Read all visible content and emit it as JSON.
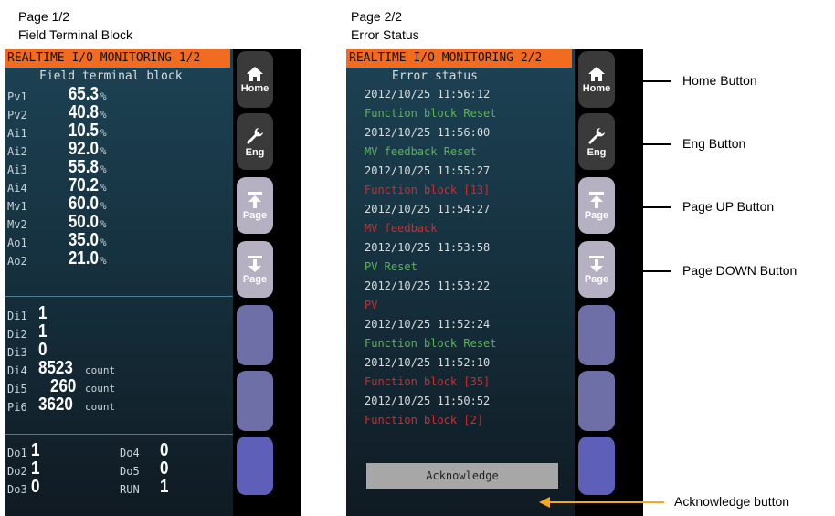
{
  "left": {
    "caption_page": "Page 1/2",
    "caption_title": "Field Terminal Block",
    "header": "REALTIME I/O MONITORING 1/2",
    "subtitle": "Field terminal block",
    "analog": [
      {
        "label": "Pv1",
        "value": "65.3",
        "unit": "%"
      },
      {
        "label": "Pv2",
        "value": "40.8",
        "unit": "%"
      },
      {
        "label": "Ai1",
        "value": "10.5",
        "unit": "%"
      },
      {
        "label": "Ai2",
        "value": "92.0",
        "unit": "%"
      },
      {
        "label": "Ai3",
        "value": "55.8",
        "unit": "%"
      },
      {
        "label": "Ai4",
        "value": "70.2",
        "unit": "%"
      },
      {
        "label": "Mv1",
        "value": "60.0",
        "unit": "%"
      },
      {
        "label": "Mv2",
        "value": "50.0",
        "unit": "%"
      },
      {
        "label": "Ao1",
        "value": "35.0",
        "unit": "%"
      },
      {
        "label": "Ao2",
        "value": "21.0",
        "unit": "%"
      }
    ],
    "digital": [
      {
        "label": "Di1",
        "value": "1",
        "unit": ""
      },
      {
        "label": "Di2",
        "value": "1",
        "unit": ""
      },
      {
        "label": "Di3",
        "value": "0",
        "unit": ""
      },
      {
        "label": "Di4",
        "value": "8523",
        "unit": "count"
      },
      {
        "label": "Di5",
        "value": "260",
        "unit": "count"
      },
      {
        "label": "Pi6",
        "value": "3620",
        "unit": "count"
      }
    ],
    "outputs": [
      {
        "label": "Do1",
        "value": "1"
      },
      {
        "label": "Do2",
        "value": "1"
      },
      {
        "label": "Do3",
        "value": "0"
      },
      {
        "label": "Do4",
        "value": "0"
      },
      {
        "label": "Do5",
        "value": "0"
      },
      {
        "label": "RUN",
        "value": "1"
      }
    ]
  },
  "right": {
    "caption_page": "Page 2/2",
    "caption_title": "Error Status",
    "header": "REALTIME I/O MONITORING 2/2",
    "subtitle": "Error status",
    "errors": [
      {
        "time": "2012/10/25 11:56:12",
        "msg": "Function block Reset",
        "color": "#5ab552"
      },
      {
        "time": "2012/10/25 11:56:00",
        "msg": "MV feedback Reset",
        "color": "#5ab552"
      },
      {
        "time": "2012/10/25 11:55:27",
        "msg": "Function block [13]",
        "color": "#d12b2b"
      },
      {
        "time": "2012/10/25 11:54:27",
        "msg": "MV feedback",
        "color": "#d12b2b"
      },
      {
        "time": "2012/10/25 11:53:58",
        "msg": "PV Reset",
        "color": "#5ab552"
      },
      {
        "time": "2012/10/25 11:53:22",
        "msg": "PV",
        "color": "#d12b2b"
      },
      {
        "time": "2012/10/25 11:52:24",
        "msg": "Function block Reset",
        "color": "#5ab552"
      },
      {
        "time": "2012/10/25 11:52:10",
        "msg": "Function block [35]",
        "color": "#d12b2b"
      },
      {
        "time": "2012/10/25 11:50:52",
        "msg": "Function block [2]",
        "color": "#d12b2b"
      }
    ],
    "ack_label": "Acknowledge"
  },
  "buttons": {
    "home": "Home",
    "eng": "Eng",
    "page_up": "Page",
    "page_down": "Page"
  },
  "annotations": {
    "home": "Home Button",
    "eng": "Eng Button",
    "page_up": "Page UP Button",
    "page_down": "Page DOWN Button",
    "ack": "Acknowledge button"
  },
  "colors": {
    "header_orange": "#f26b21",
    "reset_green": "#5ab552",
    "error_red": "#d12b2b",
    "annotation_arrow_orange": "#f5a623"
  }
}
